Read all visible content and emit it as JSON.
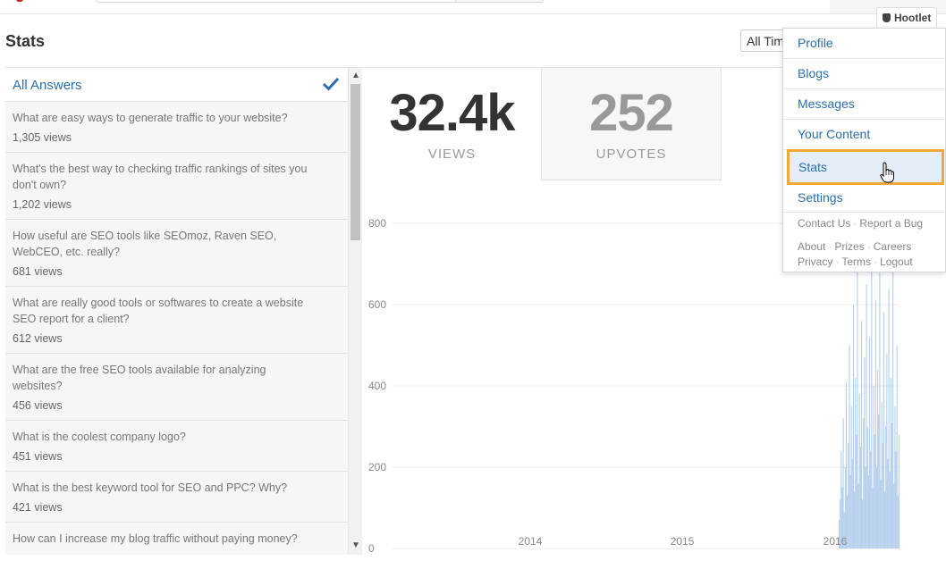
{
  "page": {
    "title": "Stats",
    "time_filter": "All Tim"
  },
  "answers": {
    "all_label": "All Answers",
    "items": [
      {
        "q": "What are easy ways to generate traffic to your website?",
        "views": "1,305 views"
      },
      {
        "q": "What's the best way to checking traffic rankings of sites you don't own?",
        "views": "1,202 views"
      },
      {
        "q": "How useful are SEO tools like SEOmoz, Raven SEO, WebCEO, etc. really?",
        "views": "681 views"
      },
      {
        "q": "What are really good tools or softwares to create a website SEO report for a client?",
        "views": "612 views"
      },
      {
        "q": "What are the free SEO tools available for analyzing websites?",
        "views": "456 views"
      },
      {
        "q": "What is the coolest company logo?",
        "views": "451 views"
      },
      {
        "q": "What is the best keyword tool for SEO and PPC? Why?",
        "views": "421 views"
      },
      {
        "q": "How can I increase my blog traffic without paying money?",
        "views": ""
      }
    ]
  },
  "stats": {
    "views": {
      "value": "32.4k",
      "label": "VIEWS"
    },
    "upvotes": {
      "value": "252",
      "label": "UPVOTES"
    }
  },
  "hootlet": {
    "label": "Hootlet"
  },
  "menu": {
    "items": [
      "Profile",
      "Blogs",
      "Messages",
      "Your Content",
      "Stats",
      "Settings"
    ],
    "active": "Stats",
    "footer1": [
      "Contact Us",
      "Report a Bug"
    ],
    "footer2": [
      "About",
      "Prizes",
      "Careers"
    ],
    "footer3": [
      "Privacy",
      "Terms",
      "Logout"
    ]
  },
  "colors": {
    "link": "#2b6dad",
    "highlight": "#f0a839",
    "bars": "#a9c8ea"
  },
  "chart_data": {
    "type": "bar",
    "y_ticks": [
      "800",
      "600",
      "400",
      "200",
      "0"
    ],
    "x_ticks": [
      "2014",
      "2015",
      "2016"
    ],
    "ylim": [
      0,
      800
    ],
    "series": [
      {
        "values": [
          70,
          120,
          240,
          150,
          320,
          90,
          200,
          410,
          130,
          260,
          500,
          180,
          350,
          220,
          600,
          140,
          420,
          280,
          700,
          160,
          380,
          250,
          560,
          120,
          320,
          470,
          200,
          650,
          300,
          180,
          520,
          240,
          760,
          150,
          400,
          280,
          610,
          200,
          440,
          330,
          700,
          170,
          360,
          260,
          580,
          140,
          300,
          480,
          220,
          640,
          190,
          420,
          310,
          720,
          160,
          350,
          240,
          500,
          130,
          280
        ]
      }
    ]
  }
}
